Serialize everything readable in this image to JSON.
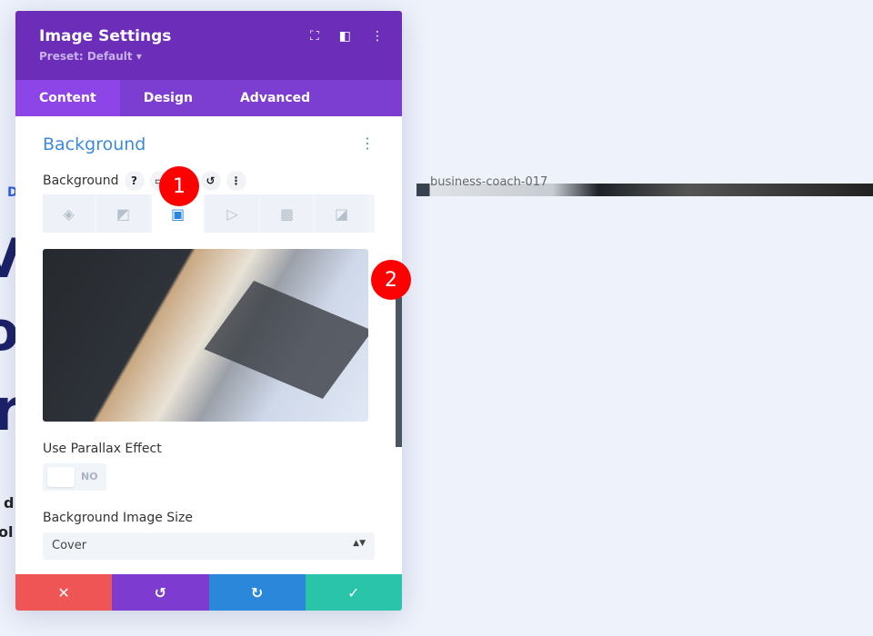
{
  "page": {
    "letters": [
      "D",
      "V",
      "o",
      "r",
      "d",
      "ol"
    ],
    "file_label": "business-coach-017"
  },
  "panel": {
    "title": "Image Settings",
    "preset": "Preset: Default ▾",
    "tabs": [
      {
        "label": "Content"
      },
      {
        "label": "Design"
      },
      {
        "label": "Advanced"
      }
    ],
    "section": "Background",
    "field_label": "Background",
    "help": "?",
    "parallax_label": "Use Parallax Effect",
    "parallax_value": "NO",
    "size_label": "Background Image Size",
    "size_value": "Cover"
  },
  "badges": [
    "1",
    "2"
  ],
  "colors": {
    "header": "#6c2eb9",
    "accent": "#2b87da",
    "cancel": "#ef5555",
    "undo": "#7e3bd0",
    "redo": "#2b87da",
    "save": "#29c4a9"
  }
}
